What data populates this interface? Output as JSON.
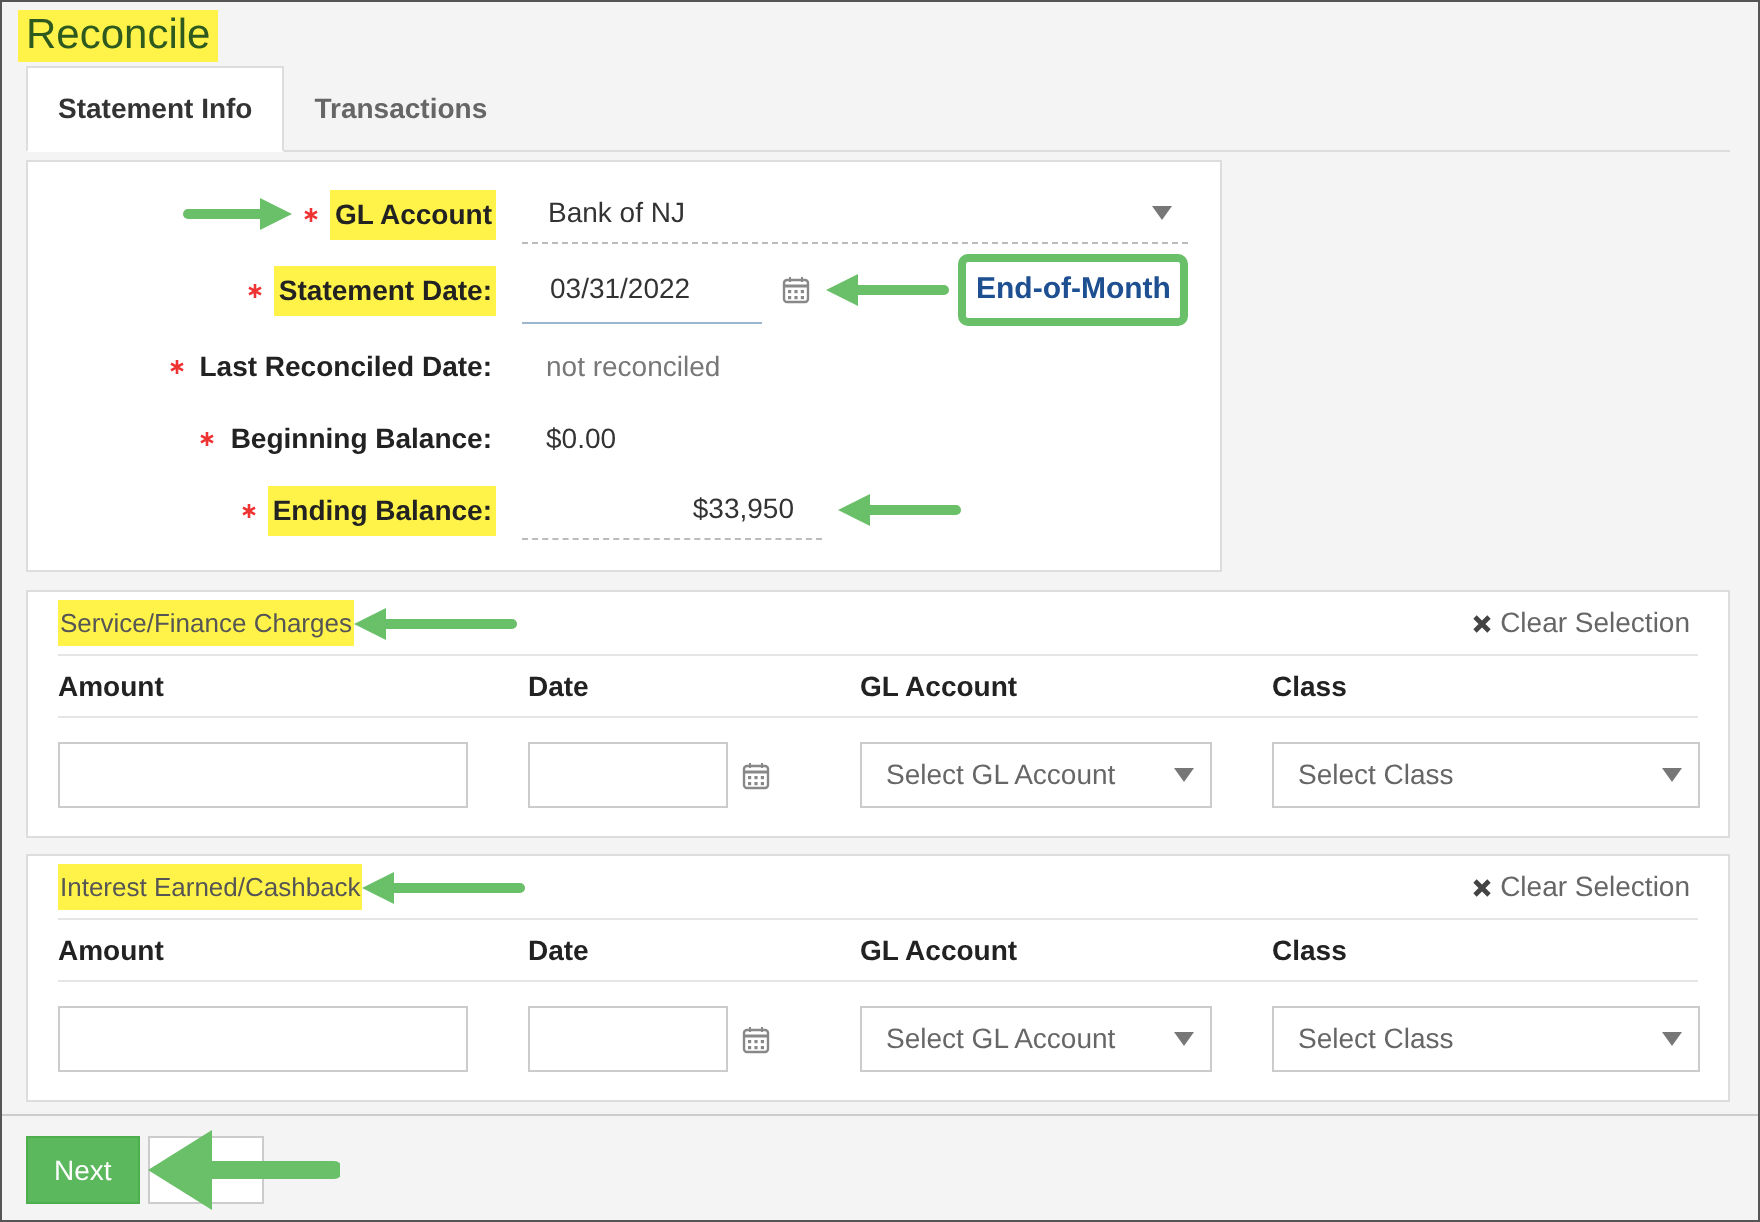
{
  "title": {
    "text": "Reconcile",
    "highlighted": true
  },
  "tabs": [
    {
      "label": "Statement Info",
      "selected": true
    },
    {
      "label": "Transactions",
      "selected": false
    }
  ],
  "fields": [
    {
      "label": "GL Account",
      "required": true,
      "highlighted": true,
      "kind": "select",
      "value": "Bank of NJ",
      "arrow_before_label": true,
      "arrow_after_value": false
    },
    {
      "label": "Statement Date:",
      "required": true,
      "highlighted": true,
      "kind": "date",
      "value": "03/31/2022",
      "arrow_before_label": false,
      "arrow_after_value": true,
      "callout": "End-of-Month"
    },
    {
      "label": "Last Reconciled Date:",
      "required": true,
      "highlighted": false,
      "kind": "muted",
      "value": "not reconciled",
      "arrow_before_label": false,
      "arrow_after_value": false
    },
    {
      "label": "Beginning Balance:",
      "required": true,
      "highlighted": false,
      "kind": "plain",
      "value": "$0.00",
      "arrow_before_label": false,
      "arrow_after_value": false
    },
    {
      "label": "Ending Balance:",
      "required": true,
      "highlighted": true,
      "kind": "amount",
      "value": "$33,950",
      "arrow_before_label": false,
      "arrow_after_value": true
    }
  ],
  "sections": [
    {
      "title": "Service/Finance Charges",
      "highlighted": true,
      "arrow": true,
      "clear": "Clear Selection",
      "columns": [
        "Amount",
        "Date",
        "GL Account",
        "Class"
      ],
      "gl_placeholder": "Select GL Account",
      "class_placeholder": "Select Class"
    },
    {
      "title": "Interest Earned/Cashback",
      "highlighted": true,
      "arrow": true,
      "clear": "Clear Selection",
      "columns": [
        "Amount",
        "Date",
        "GL Account",
        "Class"
      ],
      "gl_placeholder": "Select GL Account",
      "class_placeholder": "Select Class"
    }
  ],
  "buttons": [
    {
      "label": "Next",
      "kind": "primary"
    },
    {
      "kind": "blank"
    }
  ],
  "next_arrow": true
}
